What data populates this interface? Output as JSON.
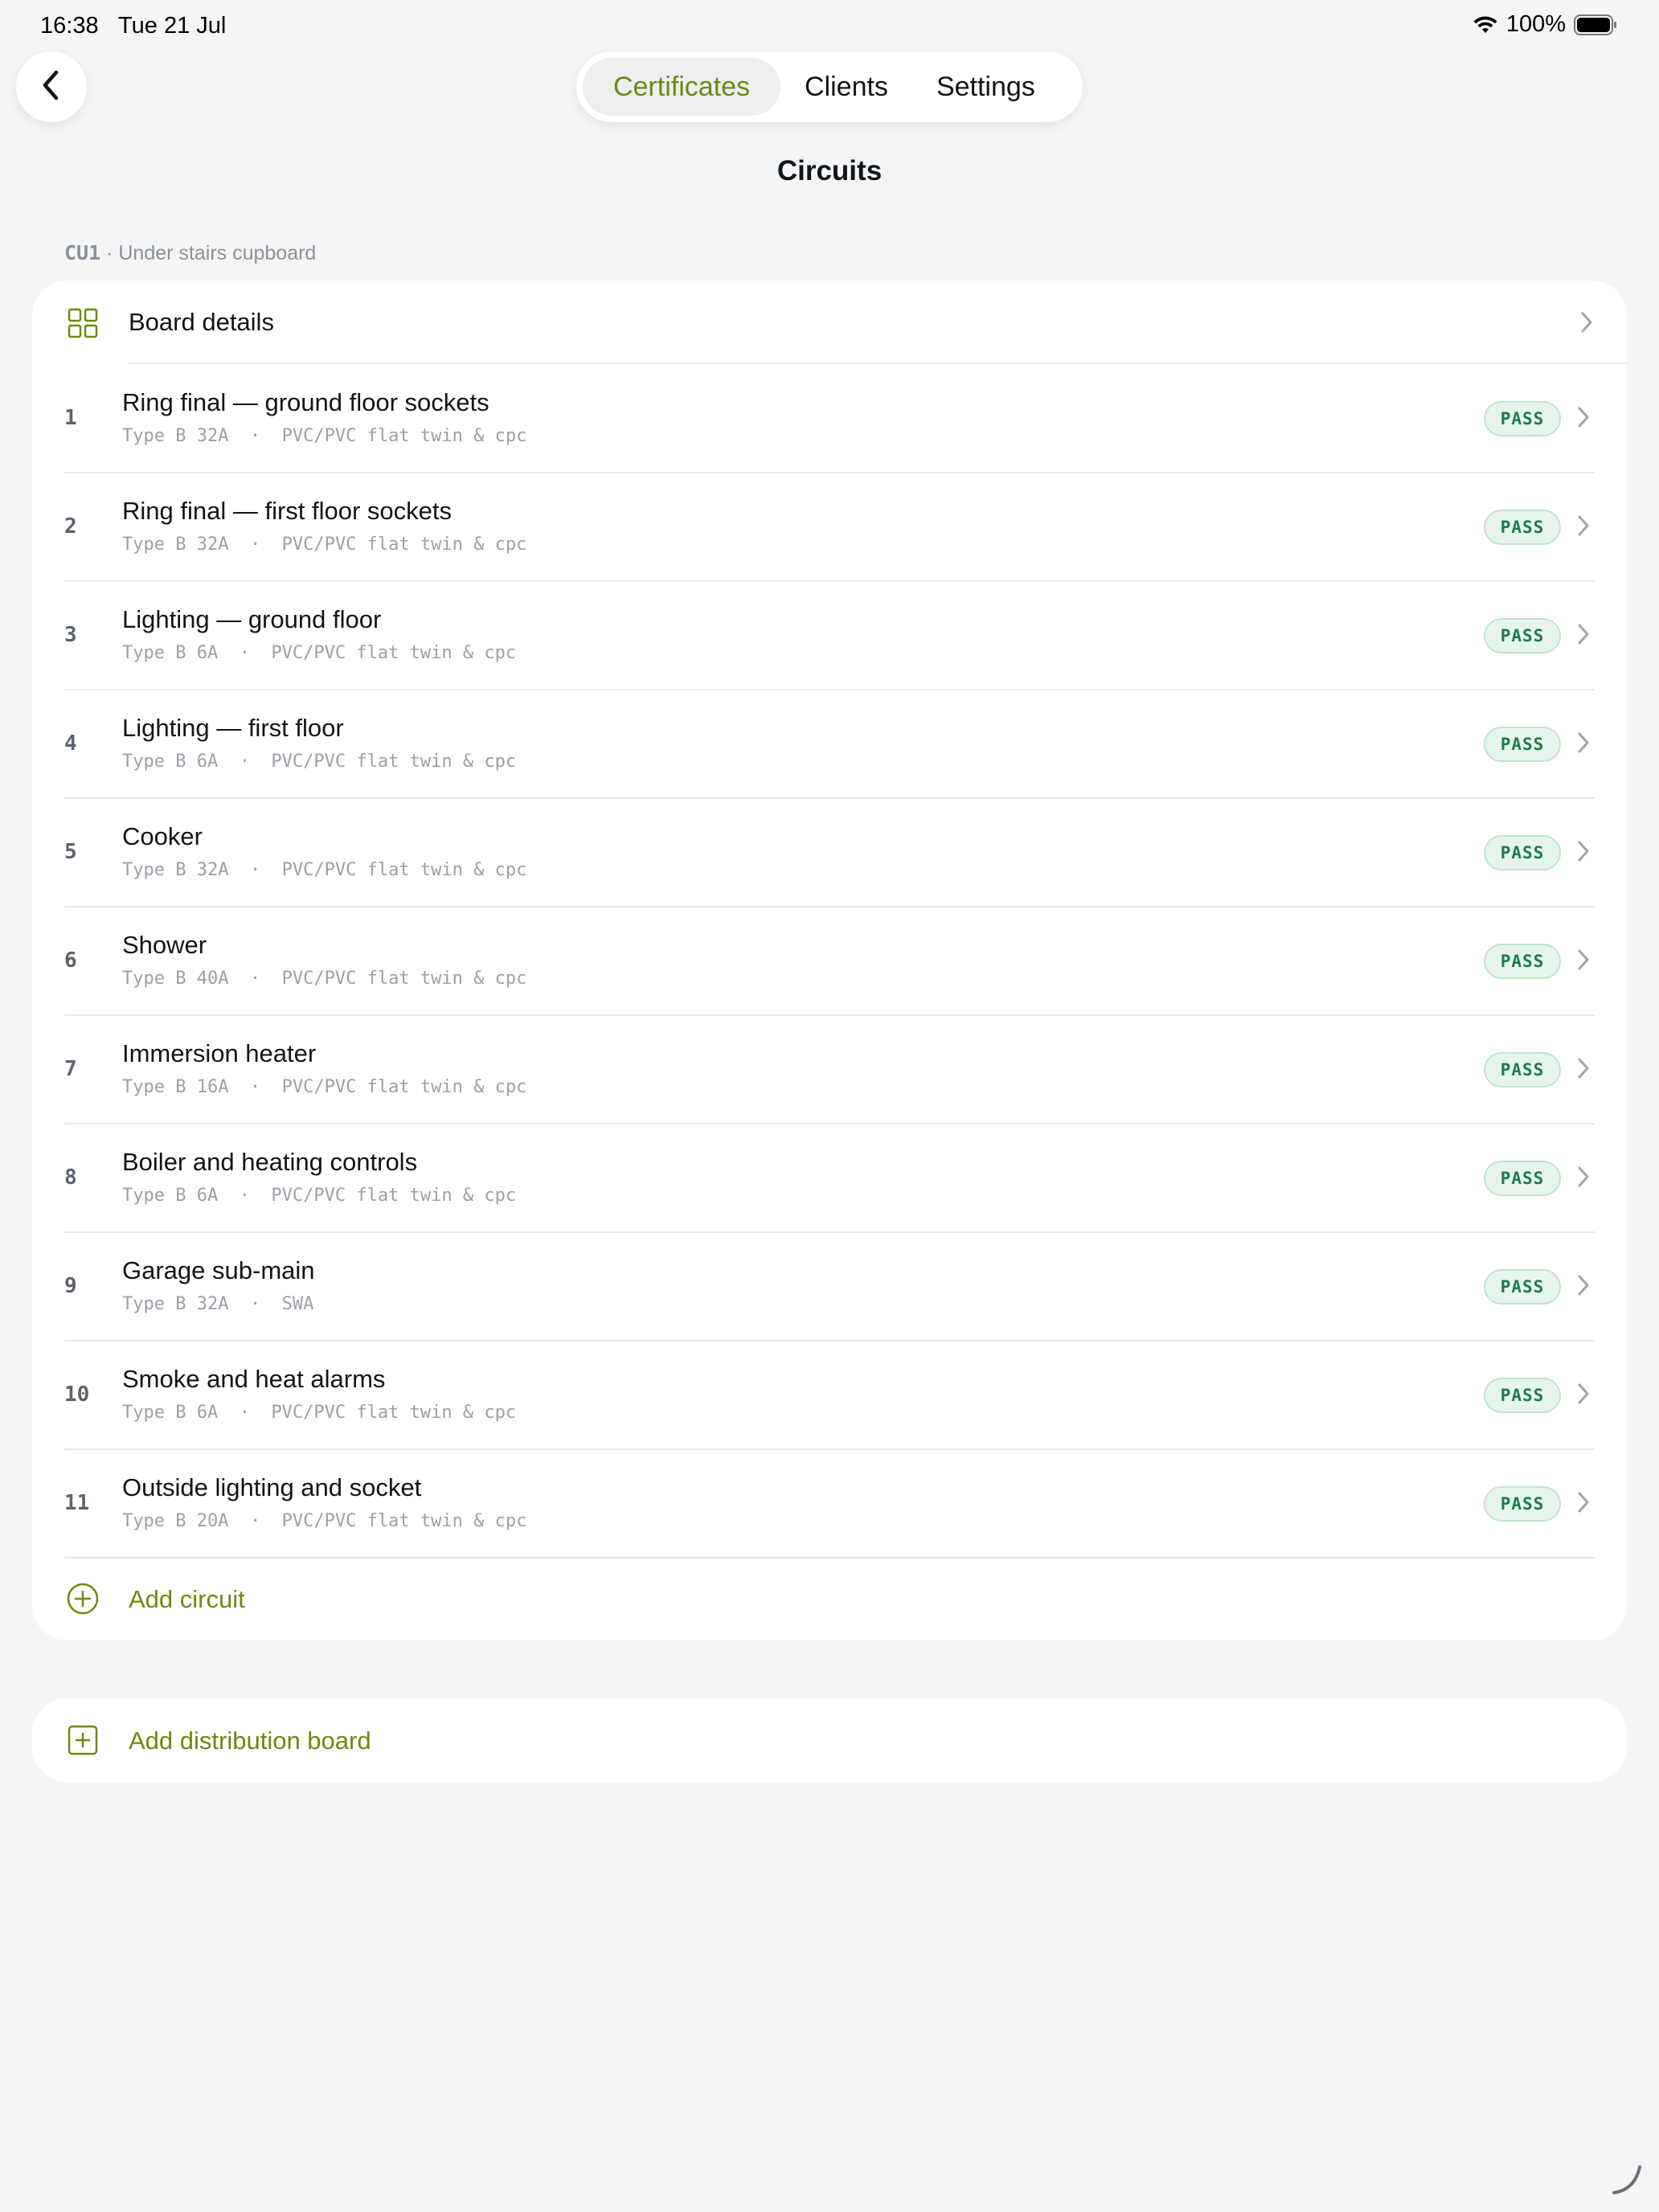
{
  "status_bar": {
    "time": "16:38",
    "date": "Tue 21 Jul",
    "battery": "100%",
    "icons": [
      "wifi-icon",
      "battery-icon"
    ]
  },
  "nav": {
    "back_icon": "chevron-left-icon",
    "tabs": [
      {
        "label": "Certificates",
        "active": true
      },
      {
        "label": "Clients",
        "active": false
      },
      {
        "label": "Settings",
        "active": false
      }
    ]
  },
  "page": {
    "title": "Circuits"
  },
  "board": {
    "code": "CU1",
    "location": "· Under stairs cupboard",
    "details_label": "Board details",
    "details_icon": "grid-icon"
  },
  "circuits": [
    {
      "num": "1",
      "name": "Ring final — ground floor sockets",
      "meta": "Type B 32A  ·  PVC/PVC flat twin & cpc",
      "status": "PASS"
    },
    {
      "num": "2",
      "name": "Ring final — first floor sockets",
      "meta": "Type B 32A  ·  PVC/PVC flat twin & cpc",
      "status": "PASS"
    },
    {
      "num": "3",
      "name": "Lighting — ground floor",
      "meta": "Type B 6A  ·  PVC/PVC flat twin & cpc",
      "status": "PASS"
    },
    {
      "num": "4",
      "name": "Lighting — first floor",
      "meta": "Type B 6A  ·  PVC/PVC flat twin & cpc",
      "status": "PASS"
    },
    {
      "num": "5",
      "name": "Cooker",
      "meta": "Type B 32A  ·  PVC/PVC flat twin & cpc",
      "status": "PASS"
    },
    {
      "num": "6",
      "name": "Shower",
      "meta": "Type B 40A  ·  PVC/PVC flat twin & cpc",
      "status": "PASS"
    },
    {
      "num": "7",
      "name": "Immersion heater",
      "meta": "Type B 16A  ·  PVC/PVC flat twin & cpc",
      "status": "PASS"
    },
    {
      "num": "8",
      "name": "Boiler and heating controls",
      "meta": "Type B 6A  ·  PVC/PVC flat twin & cpc",
      "status": "PASS"
    },
    {
      "num": "9",
      "name": "Garage sub-main",
      "meta": "Type B 32A  ·  SWA",
      "status": "PASS"
    },
    {
      "num": "10",
      "name": "Smoke and heat alarms",
      "meta": "Type B 6A  ·  PVC/PVC flat twin & cpc",
      "status": "PASS"
    },
    {
      "num": "11",
      "name": "Outside lighting and socket",
      "meta": "Type B 20A  ·  PVC/PVC flat twin & cpc",
      "status": "PASS"
    }
  ],
  "actions": {
    "add_circuit": "Add circuit",
    "add_circuit_icon": "plus-circle-icon",
    "add_board": "Add distribution board",
    "add_board_icon": "plus-square-icon"
  },
  "colors": {
    "accent": "#6a8a10",
    "background": "#f4f5f7",
    "pass_text": "#1f7a4a",
    "pass_bg": "#e6f5ec"
  }
}
